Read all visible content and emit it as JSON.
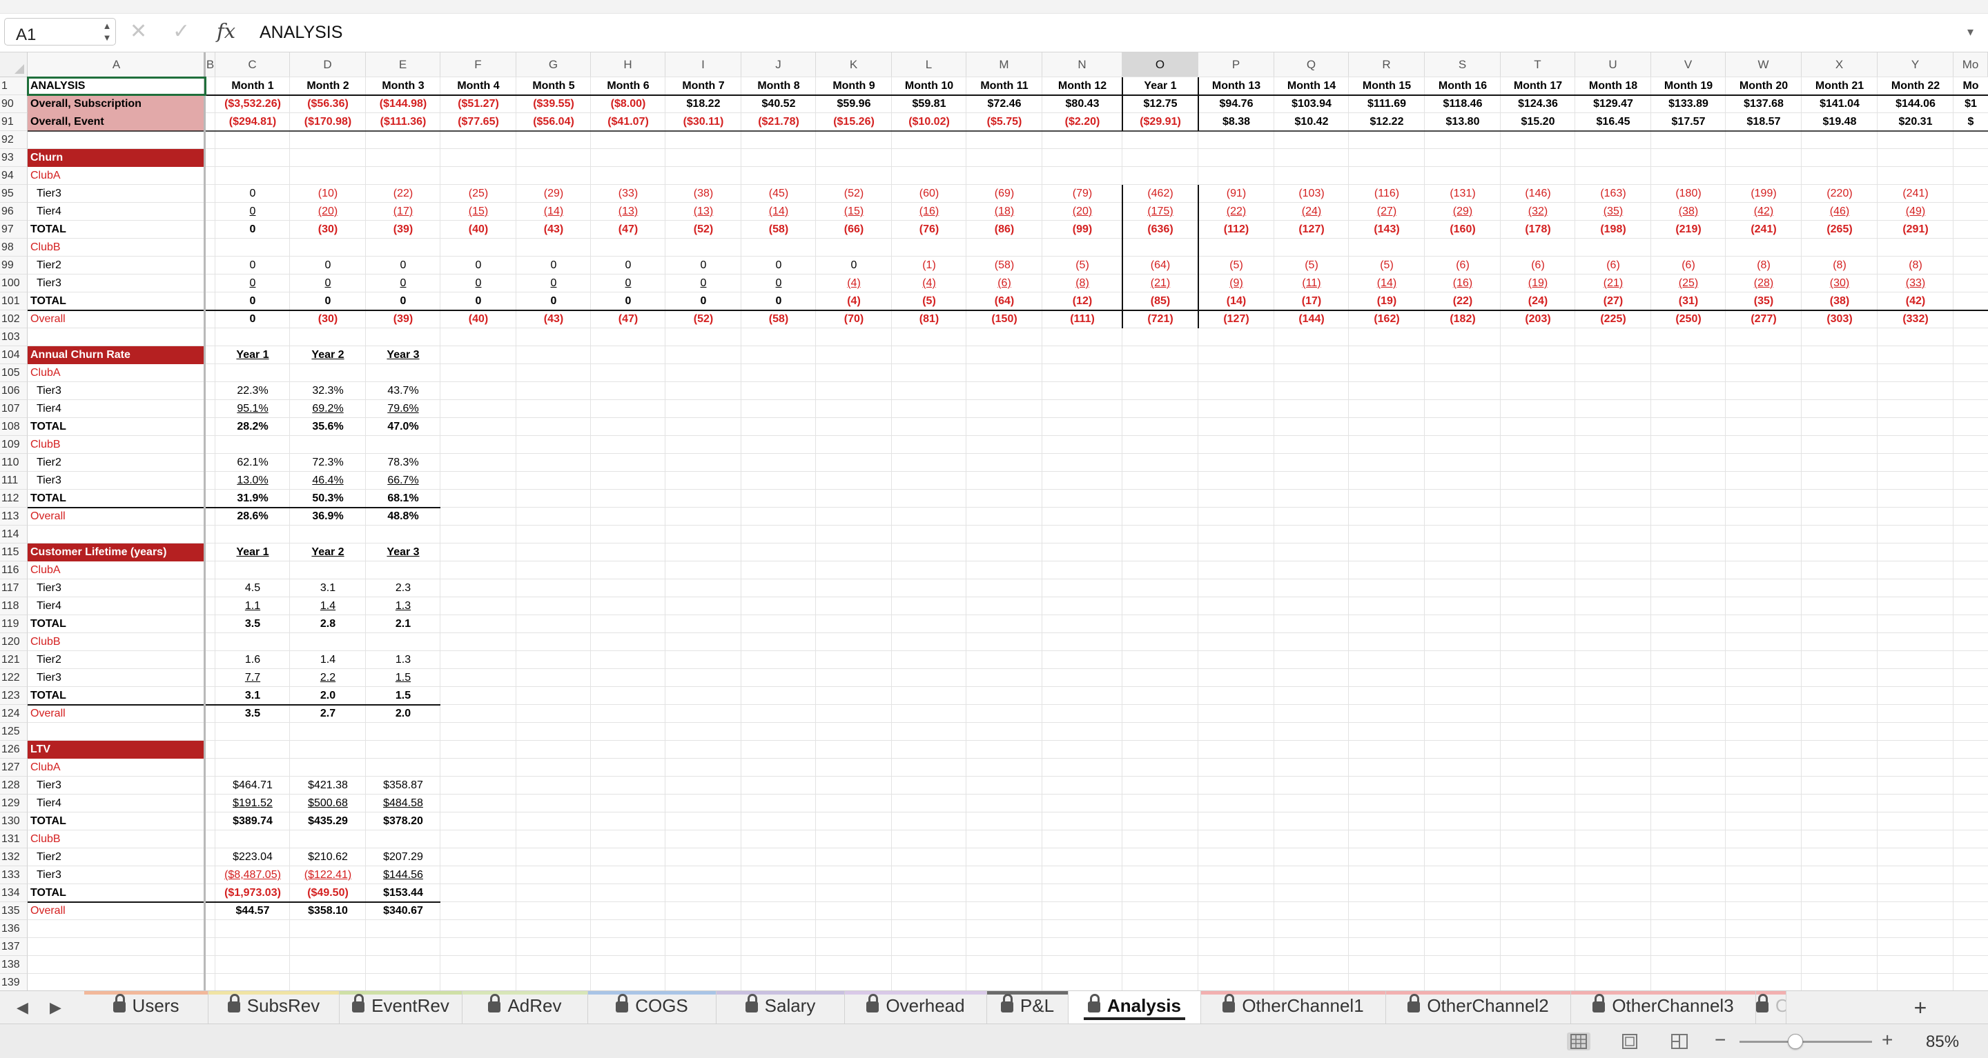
{
  "formula_bar": {
    "name_box": "A1",
    "cancel_icon": "close-icon",
    "enter_icon": "check-icon",
    "fx_label": "fx",
    "formula": "ANALYSIS"
  },
  "columns": [
    "A",
    "B",
    "C",
    "D",
    "E",
    "F",
    "G",
    "H",
    "I",
    "J",
    "K",
    "L",
    "M",
    "N",
    "O",
    "P",
    "Q",
    "R",
    "S",
    "T",
    "U",
    "V",
    "W",
    "X",
    "Y",
    "Mo"
  ],
  "selected_column": "O",
  "rows": [
    {
      "n": "1",
      "type": "lbl",
      "label": "ANALYSIS",
      "cells": [
        "Month 1",
        "Month 2",
        "Month 3",
        "Month 4",
        "Month 5",
        "Month 6",
        "Month 7",
        "Month 8",
        "Month 9",
        "Month 10",
        "Month 11",
        "Month 12",
        "Year 1",
        "Month 13",
        "Month 14",
        "Month 15",
        "Month 16",
        "Month 17",
        "Month 18",
        "Month 19",
        "Month 20",
        "Month 21",
        "Month 22",
        "Mo"
      ]
    },
    {
      "n": "90",
      "type": "pink",
      "label": "Overall, Subscription",
      "cells": [
        "($3,532.26)",
        "($56.36)",
        "($144.98)",
        "($51.27)",
        "($39.55)",
        "($8.00)",
        "$18.22",
        "$40.52",
        "$59.96",
        "$59.81",
        "$72.46",
        "$80.43",
        "$12.75",
        "$94.76",
        "$103.94",
        "$111.69",
        "$118.46",
        "$124.36",
        "$129.47",
        "$133.89",
        "$137.68",
        "$141.04",
        "$144.06",
        "$1"
      ]
    },
    {
      "n": "91",
      "type": "pink",
      "label": "Overall, Event",
      "cells": [
        "($294.81)",
        "($170.98)",
        "($111.36)",
        "($77.65)",
        "($56.04)",
        "($41.07)",
        "($30.11)",
        "($21.78)",
        "($15.26)",
        "($10.02)",
        "($5.75)",
        "($2.20)",
        "($29.91)",
        "$8.38",
        "$10.42",
        "$12.22",
        "$13.80",
        "$15.20",
        "$16.45",
        "$17.57",
        "$18.57",
        "$19.48",
        "$20.31",
        "$"
      ]
    },
    {
      "n": "92",
      "type": "blank",
      "label": "",
      "cells": []
    },
    {
      "n": "93",
      "type": "band",
      "label": "Churn",
      "cells": []
    },
    {
      "n": "94",
      "type": "redsec",
      "label": "ClubA",
      "cells": []
    },
    {
      "n": "95",
      "type": "sub",
      "label": "Tier3",
      "cells": [
        "0",
        "(10)",
        "(22)",
        "(25)",
        "(29)",
        "(33)",
        "(38)",
        "(45)",
        "(52)",
        "(60)",
        "(69)",
        "(79)",
        "(462)",
        "(91)",
        "(103)",
        "(116)",
        "(131)",
        "(146)",
        "(163)",
        "(180)",
        "(199)",
        "(220)",
        "(241)"
      ]
    },
    {
      "n": "96",
      "type": "subu",
      "label": "Tier4",
      "cells": [
        "0",
        "(20)",
        "(17)",
        "(15)",
        "(14)",
        "(13)",
        "(13)",
        "(14)",
        "(15)",
        "(16)",
        "(18)",
        "(20)",
        "(175)",
        "(22)",
        "(24)",
        "(27)",
        "(29)",
        "(32)",
        "(35)",
        "(38)",
        "(42)",
        "(46)",
        "(49)"
      ]
    },
    {
      "n": "97",
      "type": "tot",
      "label": "TOTAL",
      "cells": [
        "0",
        "(30)",
        "(39)",
        "(40)",
        "(43)",
        "(47)",
        "(52)",
        "(58)",
        "(66)",
        "(76)",
        "(86)",
        "(99)",
        "(636)",
        "(112)",
        "(127)",
        "(143)",
        "(160)",
        "(178)",
        "(198)",
        "(219)",
        "(241)",
        "(265)",
        "(291)"
      ]
    },
    {
      "n": "98",
      "type": "redsec",
      "label": "ClubB",
      "cells": []
    },
    {
      "n": "99",
      "type": "sub",
      "label": "Tier2",
      "cells": [
        "0",
        "0",
        "0",
        "0",
        "0",
        "0",
        "0",
        "0",
        "0",
        "(1)",
        "(58)",
        "(5)",
        "(64)",
        "(5)",
        "(5)",
        "(5)",
        "(6)",
        "(6)",
        "(6)",
        "(6)",
        "(8)",
        "(8)",
        "(8)"
      ]
    },
    {
      "n": "100",
      "type": "subu",
      "label": "Tier3",
      "cells": [
        "0",
        "0",
        "0",
        "0",
        "0",
        "0",
        "0",
        "0",
        "(4)",
        "(4)",
        "(6)",
        "(8)",
        "(21)",
        "(9)",
        "(11)",
        "(14)",
        "(16)",
        "(19)",
        "(21)",
        "(25)",
        "(28)",
        "(30)",
        "(33)"
      ]
    },
    {
      "n": "101",
      "type": "tot",
      "label": "TOTAL",
      "cells": [
        "0",
        "0",
        "0",
        "0",
        "0",
        "0",
        "0",
        "0",
        "(4)",
        "(5)",
        "(64)",
        "(12)",
        "(85)",
        "(14)",
        "(17)",
        "(19)",
        "(22)",
        "(24)",
        "(27)",
        "(31)",
        "(35)",
        "(38)",
        "(42)"
      ]
    },
    {
      "n": "102",
      "type": "overall",
      "label": "Overall",
      "cells": [
        "0",
        "(30)",
        "(39)",
        "(40)",
        "(43)",
        "(47)",
        "(52)",
        "(58)",
        "(70)",
        "(81)",
        "(150)",
        "(111)",
        "(721)",
        "(127)",
        "(144)",
        "(162)",
        "(182)",
        "(203)",
        "(225)",
        "(250)",
        "(277)",
        "(303)",
        "(332)"
      ]
    },
    {
      "n": "103",
      "type": "blank",
      "label": "",
      "cells": []
    },
    {
      "n": "104",
      "type": "band",
      "label": "Annual Churn Rate",
      "cells": [
        "Year 1",
        "Year 2",
        "Year 3"
      ]
    },
    {
      "n": "105",
      "type": "redsec",
      "label": "ClubA",
      "cells": []
    },
    {
      "n": "106",
      "type": "sub",
      "label": "Tier3",
      "cells": [
        "22.3%",
        "32.3%",
        "43.7%"
      ]
    },
    {
      "n": "107",
      "type": "subu",
      "label": "Tier4",
      "cells": [
        "95.1%",
        "69.2%",
        "79.6%"
      ]
    },
    {
      "n": "108",
      "type": "tot",
      "label": "TOTAL",
      "cells": [
        "28.2%",
        "35.6%",
        "47.0%"
      ]
    },
    {
      "n": "109",
      "type": "redsec",
      "label": "ClubB",
      "cells": []
    },
    {
      "n": "110",
      "type": "sub",
      "label": "Tier2",
      "cells": [
        "62.1%",
        "72.3%",
        "78.3%"
      ]
    },
    {
      "n": "111",
      "type": "subu",
      "label": "Tier3",
      "cells": [
        "13.0%",
        "46.4%",
        "66.7%"
      ]
    },
    {
      "n": "112",
      "type": "tot",
      "label": "TOTAL",
      "cells": [
        "31.9%",
        "50.3%",
        "68.1%"
      ]
    },
    {
      "n": "113",
      "type": "overall",
      "label": "Overall",
      "cells": [
        "28.6%",
        "36.9%",
        "48.8%"
      ]
    },
    {
      "n": "114",
      "type": "blank",
      "label": "",
      "cells": []
    },
    {
      "n": "115",
      "type": "band",
      "label": "Customer Lifetime (years)",
      "cells": [
        "Year 1",
        "Year 2",
        "Year 3"
      ]
    },
    {
      "n": "116",
      "type": "redsec",
      "label": "ClubA",
      "cells": []
    },
    {
      "n": "117",
      "type": "sub",
      "label": "Tier3",
      "cells": [
        "4.5",
        "3.1",
        "2.3"
      ]
    },
    {
      "n": "118",
      "type": "subu",
      "label": "Tier4",
      "cells": [
        "1.1",
        "1.4",
        "1.3"
      ]
    },
    {
      "n": "119",
      "type": "tot",
      "label": "TOTAL",
      "cells": [
        "3.5",
        "2.8",
        "2.1"
      ]
    },
    {
      "n": "120",
      "type": "redsec",
      "label": "ClubB",
      "cells": []
    },
    {
      "n": "121",
      "type": "sub",
      "label": "Tier2",
      "cells": [
        "1.6",
        "1.4",
        "1.3"
      ]
    },
    {
      "n": "122",
      "type": "subu",
      "label": "Tier3",
      "cells": [
        "7.7",
        "2.2",
        "1.5"
      ]
    },
    {
      "n": "123",
      "type": "tot",
      "label": "TOTAL",
      "cells": [
        "3.1",
        "2.0",
        "1.5"
      ]
    },
    {
      "n": "124",
      "type": "overall",
      "label": "Overall",
      "cells": [
        "3.5",
        "2.7",
        "2.0"
      ]
    },
    {
      "n": "125",
      "type": "blank",
      "label": "",
      "cells": []
    },
    {
      "n": "126",
      "type": "band",
      "label": "LTV",
      "cells": []
    },
    {
      "n": "127",
      "type": "redsec",
      "label": "ClubA",
      "cells": []
    },
    {
      "n": "128",
      "type": "sub",
      "label": "Tier3",
      "cells": [
        "$464.71",
        "$421.38",
        "$358.87"
      ]
    },
    {
      "n": "129",
      "type": "subu",
      "label": "Tier4",
      "cells": [
        "$191.52",
        "$500.68",
        "$484.58"
      ]
    },
    {
      "n": "130",
      "type": "tot",
      "label": "TOTAL",
      "cells": [
        "$389.74",
        "$435.29",
        "$378.20"
      ]
    },
    {
      "n": "131",
      "type": "redsec",
      "label": "ClubB",
      "cells": []
    },
    {
      "n": "132",
      "type": "sub",
      "label": "Tier2",
      "cells": [
        "$223.04",
        "$210.62",
        "$207.29"
      ]
    },
    {
      "n": "133",
      "type": "subu",
      "label": "Tier3",
      "cells": [
        "($8,487.05)",
        "($122.41)",
        "$144.56"
      ]
    },
    {
      "n": "134",
      "type": "tot",
      "label": "TOTAL",
      "cells": [
        "($1,973.03)",
        "($49.50)",
        "$153.44"
      ]
    },
    {
      "n": "135",
      "type": "overall",
      "label": "Overall",
      "cells": [
        "$44.57",
        "$358.10",
        "$340.67"
      ]
    },
    {
      "n": "136",
      "type": "blank",
      "label": "",
      "cells": []
    },
    {
      "n": "137",
      "type": "blank",
      "label": "",
      "cells": []
    },
    {
      "n": "138",
      "type": "blank",
      "label": "",
      "cells": []
    },
    {
      "n": "139",
      "type": "blank",
      "label": "",
      "cells": []
    }
  ],
  "sheet_tabs": [
    {
      "label": "Users",
      "color": "#f2b89a"
    },
    {
      "label": "SubsRev",
      "color": "#f0e4a4"
    },
    {
      "label": "EventRev",
      "color": "#cfe0a6"
    },
    {
      "label": "AdRev",
      "color": "#d8e6b8"
    },
    {
      "label": "COGS",
      "color": "#a9c4e6"
    },
    {
      "label": "Salary",
      "color": "#c9c0e0"
    },
    {
      "label": "Overhead",
      "color": "#d9c9e8"
    },
    {
      "label": "P&L",
      "color": "#6c6c6c"
    },
    {
      "label": "Analysis",
      "color": "#ffffff",
      "active": true
    },
    {
      "label": "OtherChannel1",
      "color": "#f2b0b0"
    },
    {
      "label": "OtherChannel2",
      "color": "#f2b0b0"
    },
    {
      "label": "OtherChannel3",
      "color": "#f2b0b0"
    },
    {
      "label": "O",
      "color": "#f2b0b0"
    }
  ],
  "tab_nav": {
    "prev_icon": "chevron-left-icon",
    "next_icon": "chevron-right-icon",
    "add_icon": "plus-icon",
    "add_label": "+"
  },
  "status_bar": {
    "views": [
      "normal-view-icon",
      "page-layout-icon",
      "page-break-icon"
    ],
    "zoom_out": "−",
    "zoom_in": "+",
    "zoom": "85%"
  },
  "colors": {
    "accent_red": "#b52021",
    "text_red": "#d42020",
    "pink_fill": "#e2a9a9",
    "selection_green": "#1f6f3b"
  }
}
